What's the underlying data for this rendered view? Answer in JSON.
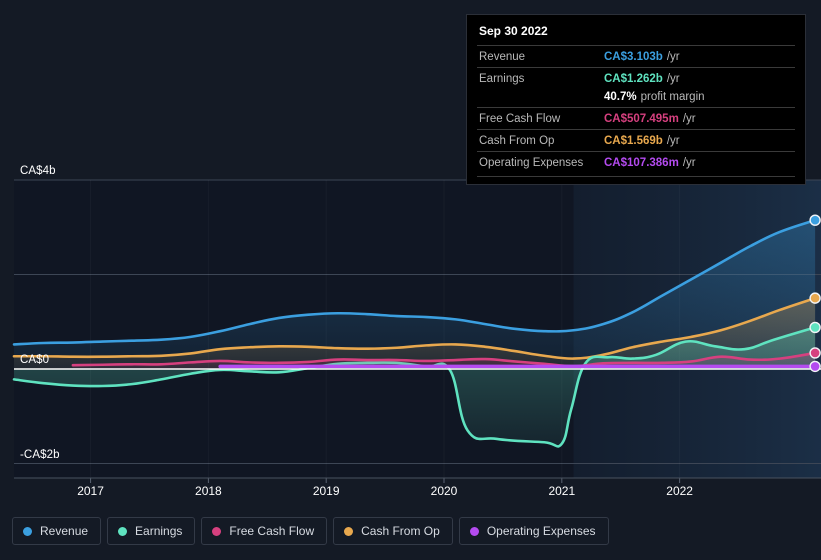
{
  "tooltip": {
    "date": "Sep 30 2022",
    "rows": [
      {
        "name": "Revenue",
        "value": "CA$3.103b",
        "unit": "/yr",
        "color": "#3b9fe0"
      },
      {
        "name": "Earnings",
        "value": "CA$1.262b",
        "unit": "/yr",
        "color": "#5fe3c0"
      },
      {
        "name": "Free Cash Flow",
        "value": "CA$507.495m",
        "unit": "/yr",
        "color": "#d6407f"
      },
      {
        "name": "Cash From Op",
        "value": "CA$1.569b",
        "unit": "/yr",
        "color": "#e8a84e"
      },
      {
        "name": "Operating Expenses",
        "value": "CA$107.386m",
        "unit": "/yr",
        "color": "#b44bf0"
      }
    ],
    "submetric": {
      "value": "40.7%",
      "label": "profit margin"
    }
  },
  "legend": [
    {
      "label": "Revenue",
      "color": "#3b9fe0"
    },
    {
      "label": "Earnings",
      "color": "#5fe3c0"
    },
    {
      "label": "Free Cash Flow",
      "color": "#d6407f"
    },
    {
      "label": "Cash From Op",
      "color": "#e8a84e"
    },
    {
      "label": "Operating Expenses",
      "color": "#b44bf0"
    }
  ],
  "chart_data": {
    "type": "area",
    "title": "",
    "xlabel": "",
    "ylabel": "",
    "currency": "CA$",
    "grid": true,
    "legend_position": "bottom",
    "xlim": [
      2016.35,
      2023.2
    ],
    "ylim": [
      -2.6,
      4.4
    ],
    "y_ticks": [
      4,
      2,
      0,
      -2
    ],
    "y_tick_labels": [
      "CA$4b",
      "",
      "CA$0",
      "-CA$2b"
    ],
    "x_ticks": [
      2017,
      2018,
      2019,
      2020,
      2021,
      2022
    ],
    "x_tick_labels": [
      "2017",
      "2018",
      "2019",
      "2020",
      "2021",
      "2022"
    ],
    "forecast_start": 2021.1,
    "series": [
      {
        "name": "Revenue",
        "color": "#3b9fe0",
        "x": [
          2016.35,
          2016.6,
          2016.85,
          2017.1,
          2017.35,
          2017.6,
          2017.85,
          2018.1,
          2018.35,
          2018.6,
          2018.85,
          2019.1,
          2019.35,
          2019.6,
          2019.85,
          2020.1,
          2020.35,
          2020.6,
          2020.85,
          2021.1,
          2021.35,
          2021.6,
          2021.85,
          2022.1,
          2022.35,
          2022.6,
          2022.85,
          2023.15
        ],
        "y": [
          0.52,
          0.55,
          0.56,
          0.58,
          0.6,
          0.62,
          0.68,
          0.8,
          0.95,
          1.08,
          1.15,
          1.18,
          1.16,
          1.12,
          1.1,
          1.05,
          0.95,
          0.85,
          0.8,
          0.82,
          0.95,
          1.2,
          1.55,
          1.9,
          2.25,
          2.6,
          2.9,
          3.15
        ]
      },
      {
        "name": "Cash From Op",
        "color": "#e8a84e",
        "x": [
          2016.35,
          2016.6,
          2016.85,
          2017.1,
          2017.35,
          2017.6,
          2017.85,
          2018.1,
          2018.35,
          2018.6,
          2018.85,
          2019.1,
          2019.35,
          2019.6,
          2019.85,
          2020.1,
          2020.35,
          2020.6,
          2020.85,
          2021.1,
          2021.35,
          2021.6,
          2021.85,
          2022.1,
          2022.35,
          2022.6,
          2022.85,
          2023.15
        ],
        "y": [
          0.27,
          0.27,
          0.26,
          0.26,
          0.27,
          0.28,
          0.33,
          0.42,
          0.46,
          0.48,
          0.47,
          0.44,
          0.43,
          0.45,
          0.5,
          0.52,
          0.47,
          0.38,
          0.28,
          0.22,
          0.3,
          0.46,
          0.58,
          0.68,
          0.82,
          1.02,
          1.25,
          1.5
        ]
      },
      {
        "name": "Earnings",
        "color": "#5fe3c0",
        "x": [
          2016.35,
          2016.6,
          2016.85,
          2017.1,
          2017.35,
          2017.6,
          2017.85,
          2018.1,
          2018.35,
          2018.6,
          2018.85,
          2019.1,
          2019.35,
          2019.6,
          2019.85,
          2020.05,
          2020.2,
          2020.45,
          2020.85,
          2021.0,
          2021.08,
          2021.2,
          2021.4,
          2021.6,
          2021.8,
          2022.05,
          2022.3,
          2022.55,
          2022.8,
          2023.15
        ],
        "y": [
          -0.22,
          -0.3,
          -0.35,
          -0.36,
          -0.32,
          -0.22,
          -0.1,
          -0.02,
          -0.05,
          -0.07,
          0.02,
          0.11,
          0.13,
          0.13,
          0.05,
          -0.02,
          -1.3,
          -1.48,
          -1.55,
          -1.58,
          -0.85,
          0.12,
          0.25,
          0.22,
          0.3,
          0.58,
          0.48,
          0.42,
          0.62,
          0.88
        ]
      },
      {
        "name": "Free Cash Flow",
        "color": "#d6407f",
        "x": [
          2016.85,
          2017.1,
          2017.35,
          2017.6,
          2017.85,
          2018.1,
          2018.35,
          2018.6,
          2018.85,
          2019.1,
          2019.35,
          2019.6,
          2019.85,
          2020.1,
          2020.35,
          2020.6,
          2020.85,
          2021.1,
          2021.35,
          2021.6,
          2021.85,
          2022.1,
          2022.35,
          2022.6,
          2022.85,
          2023.15
        ],
        "y": [
          0.08,
          0.09,
          0.1,
          0.1,
          0.14,
          0.17,
          0.14,
          0.13,
          0.15,
          0.2,
          0.19,
          0.19,
          0.17,
          0.19,
          0.21,
          0.16,
          0.11,
          0.06,
          0.12,
          0.13,
          0.13,
          0.16,
          0.26,
          0.2,
          0.22,
          0.34
        ]
      },
      {
        "name": "Operating Expenses",
        "color": "#b44bf0",
        "x": [
          2018.1,
          2018.6,
          2019.1,
          2019.6,
          2020.1,
          2020.6,
          2021.1,
          2021.6,
          2022.1,
          2022.6,
          2023.15
        ],
        "y": [
          0.055,
          0.055,
          0.055,
          0.055,
          0.055,
          0.055,
          0.055,
          0.055,
          0.055,
          0.055,
          0.055
        ]
      }
    ]
  }
}
